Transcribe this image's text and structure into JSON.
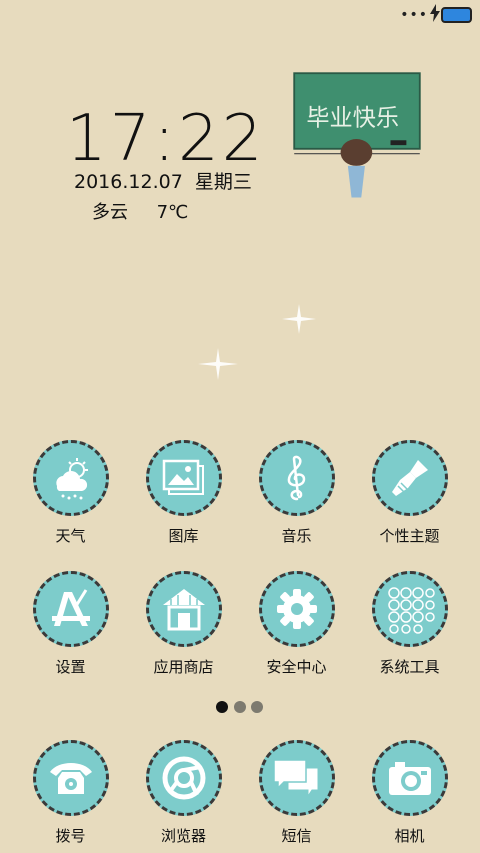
{
  "status_bar": {
    "signal": "•••"
  },
  "lockscreen": {
    "time": "17:22",
    "date": "2016.12.07",
    "weekday": "星期三",
    "weather": "多云",
    "temperature": "7℃",
    "chalkboard_text": "毕业快乐"
  },
  "apps_row1": [
    {
      "label": "天气",
      "icon": "weather-icon"
    },
    {
      "label": "图库",
      "icon": "gallery-icon"
    },
    {
      "label": "音乐",
      "icon": "music-icon"
    },
    {
      "label": "个性主题",
      "icon": "theme-brush-icon"
    }
  ],
  "apps_row2": [
    {
      "label": "设置",
      "icon": "settings-icon"
    },
    {
      "label": "应用商店",
      "icon": "app-store-icon"
    },
    {
      "label": "安全中心",
      "icon": "security-gear-icon"
    },
    {
      "label": "系统工具",
      "icon": "system-tools-icon"
    }
  ],
  "dock": [
    {
      "label": "拨号",
      "icon": "phone-icon"
    },
    {
      "label": "浏览器",
      "icon": "browser-icon"
    },
    {
      "label": "短信",
      "icon": "messages-icon"
    },
    {
      "label": "相机",
      "icon": "camera-icon"
    }
  ],
  "page_indicator": {
    "pages": 3,
    "current": 1
  },
  "colors": {
    "background": "#e7dbbe",
    "icon_fill": "#7dcccb",
    "chalkboard": "#3f8f6f"
  }
}
